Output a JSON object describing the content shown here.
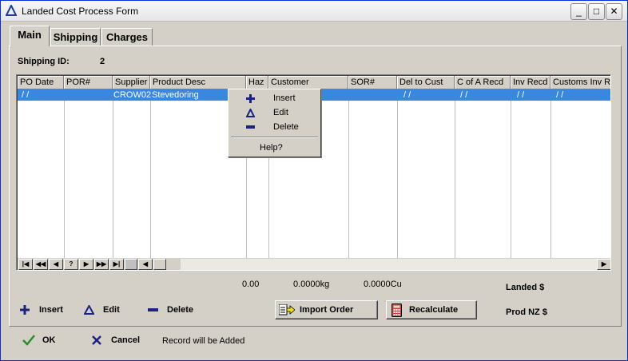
{
  "window": {
    "title": "Landed Cost Process Form",
    "minimize": "_",
    "maximize": "□",
    "close": "✕"
  },
  "tabs": [
    "Main",
    "Shipping",
    "Charges"
  ],
  "shipping": {
    "label": "Shipping ID:",
    "value": "2"
  },
  "grid": {
    "columns": [
      "PO Date",
      "POR#",
      "Supplier",
      "Product Desc",
      "Haz",
      "Customer",
      "SOR#",
      "Del to Cust",
      "C of A Recd",
      "Inv Recd",
      "Customs Inv Re"
    ],
    "row": {
      "po_date": " /  /",
      "supplier": "CROW02",
      "product": "Stevedoring",
      "del_to_cust": " /  /",
      "c_of_a": " /  /",
      "inv_recd": " /  /",
      "customs_inv": " /  /"
    },
    "nav": [
      "|◀",
      "◀◀",
      "◀",
      "?",
      "▶",
      "▶▶",
      "▶|"
    ]
  },
  "context_menu": {
    "insert": "Insert",
    "edit": "Edit",
    "delete": "Delete",
    "help": "Help?"
  },
  "totals": {
    "amount": "0.00",
    "weight": "0.0000kg",
    "volume": "0.0000Cu",
    "landed_label": "Landed $",
    "prod_label": "Prod NZ $"
  },
  "actions": {
    "insert": "Insert",
    "edit": "Edit",
    "delete": "Delete",
    "import_order": "Import Order",
    "recalculate": "Recalculate"
  },
  "footer": {
    "ok": "OK",
    "cancel": "Cancel",
    "status": "Record will be Added"
  },
  "colors": {
    "selection": "#3a87e0",
    "icon_blue": "#1a237e",
    "ok_green": "#2e8b2e"
  }
}
